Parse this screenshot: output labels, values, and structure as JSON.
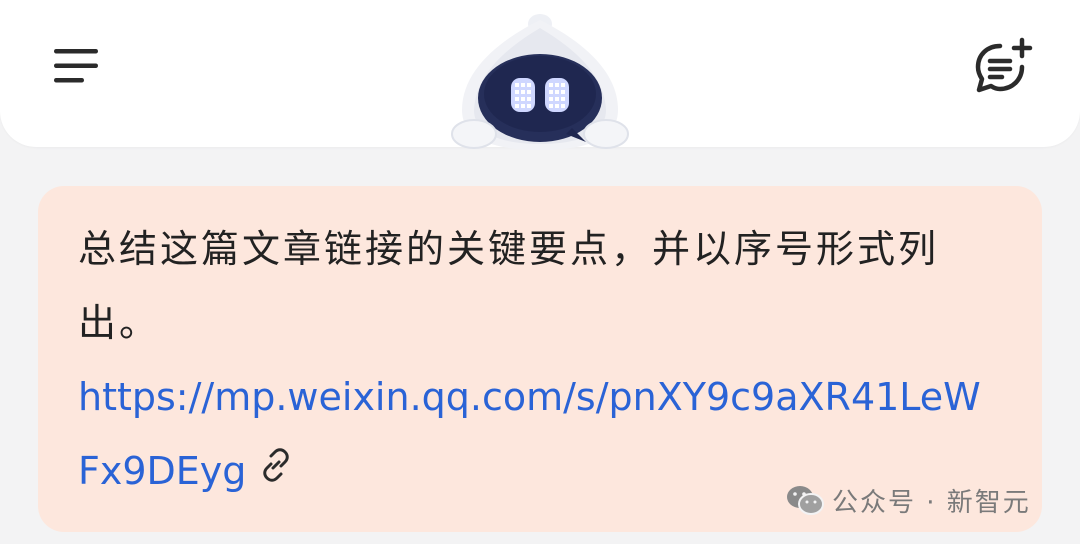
{
  "header": {
    "menu_icon": "menu-icon",
    "new_chat_icon": "new-chat-icon",
    "mascot": "robot-mascot"
  },
  "message": {
    "text": "总结这篇文章链接的关键要点，并以序号形式列出。",
    "link": "https://mp.weixin.qq.com/s/pnXY9c9aXR41LeWFx9DEyg",
    "link_icon": "link-icon",
    "bubble_color": "#fde7dd",
    "link_color": "#2a63d6"
  },
  "watermark": {
    "icon": "wechat-icon",
    "text": "公众号 · 新智元"
  }
}
